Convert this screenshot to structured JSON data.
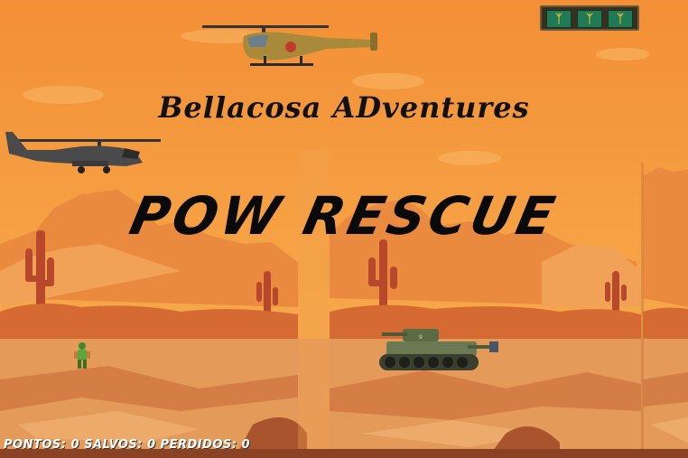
{
  "game": {
    "subtitle": "Bellacosa ADventures",
    "title": "POW RESCUE",
    "hud": {
      "score_label": "PONTOS",
      "score": "0",
      "saved_label": "SALVOS",
      "saved": "0",
      "lost_label": "PERDIDOS",
      "lost": "0",
      "text": "PONTOS: 0 SALVOS: 0 PERDIDOS: 0"
    },
    "lives": {
      "count": 3,
      "icon": "soldier-life-icon"
    },
    "sprites": [
      "civilian-helicopter",
      "apache-helicopter",
      "pow-soldier",
      "enemy-tank"
    ],
    "colors": {
      "sky_top": "#f49a3a",
      "sky_bottom": "#f7b04e",
      "mesa": "#e6843a",
      "mesa_dark": "#c9622a",
      "ground": "#e39857",
      "ground_dark": "#c56c3a",
      "cactus": "#b5462a"
    }
  }
}
